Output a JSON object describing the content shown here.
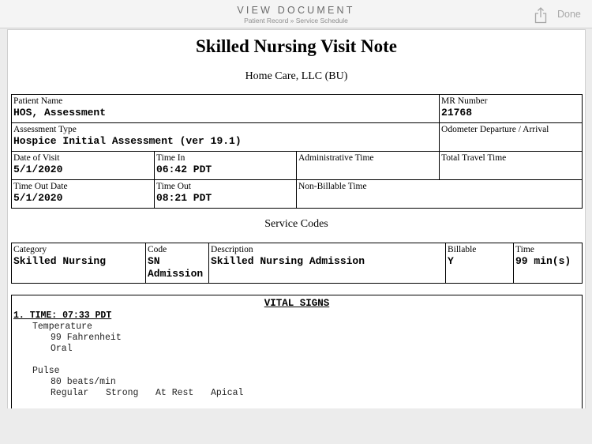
{
  "nav": {
    "title": "VIEW DOCUMENT",
    "breadcrumb": "Patient Record » Service Schedule",
    "done_label": "Done"
  },
  "doc": {
    "title": "Skilled Nursing Visit Note",
    "subtitle": "Home Care, LLC (BU)"
  },
  "info": {
    "patient_name_label": "Patient Name",
    "patient_name": "HOS, Assessment",
    "mr_label": "MR Number",
    "mr": "21768",
    "assessment_type_label": "Assessment Type",
    "assessment_type": "Hospice Initial Assessment (ver 19.1)",
    "odometer_label": "Odometer Departure / Arrival",
    "date_of_visit_label": "Date of Visit",
    "date_of_visit": "5/1/2020",
    "time_in_label": "Time In",
    "time_in": "06:42 PDT",
    "admin_time_label": "Administrative Time",
    "travel_time_label": "Total Travel Time",
    "time_out_date_label": "Time Out Date",
    "time_out_date": "5/1/2020",
    "time_out_label": "Time Out",
    "time_out": "08:21 PDT",
    "nonbillable_label": "Non-Billable Time"
  },
  "service_codes": {
    "heading": "Service Codes",
    "headers": {
      "category": "Category",
      "code": "Code",
      "description": "Description",
      "billable": "Billable",
      "time": "Time"
    },
    "row": {
      "category": "Skilled Nursing",
      "code_line1": "SN",
      "code_line2": "Admission",
      "description": "Skilled Nursing Admission",
      "billable": "Y",
      "time": "99 min(s)"
    }
  },
  "vitals": {
    "title": "VITAL SIGNS",
    "entry_label": "1. TIME: 07:33 PDT",
    "temperature_label": "Temperature",
    "temperature_value": "99 Fahrenheit",
    "temperature_route": "Oral",
    "pulse_label": "Pulse",
    "pulse_value": "80 beats/min",
    "pulse_regularity": "Regular",
    "pulse_strength": "Strong",
    "pulse_state": "At Rest",
    "pulse_site": "Apical"
  }
}
